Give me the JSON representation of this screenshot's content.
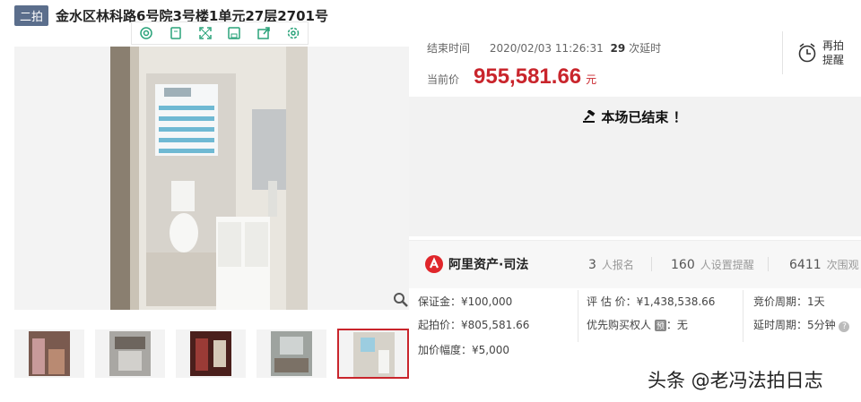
{
  "header": {
    "tag": "二拍",
    "title": "金水区林科路6号院3号楼1单元27层2701号"
  },
  "toolbar": {
    "icons": [
      "at-icon",
      "copy-icon",
      "fullscreen-icon",
      "save-icon",
      "share-icon",
      "settings-icon"
    ]
  },
  "auction": {
    "end_label": "结束时间",
    "end_time": "2020/02/03 11:26:31",
    "delay_count": "29",
    "delay_label": "次延时",
    "price_label": "当前价",
    "price": "955,581.66",
    "price_unit": "元",
    "remind_label": "再拍提醒",
    "ended_text": "本场已结束 ！"
  },
  "stats": {
    "logo_text": "阿里资产·司法",
    "signups_num": "3",
    "signups_label": "人报名",
    "reminders_num": "160",
    "reminders_label": "人设置提醒",
    "views_num": "6411",
    "views_label": "次围观"
  },
  "details": {
    "deposit": "保证金：¥100,000",
    "start_price": "起拍价：¥805,581.66",
    "increment": "加价幅度：¥5,000",
    "appraisal": "评 估 价：¥1,438,538.66",
    "priority_label": "优先购买权人",
    "priority_badge": "预",
    "priority_value": "：无",
    "cycle": "竞价周期：1天",
    "delay_cycle": "延时周期：5分钟"
  },
  "watermark": "头条 @老冯法拍日志",
  "colors": {
    "accent": "#c9252c",
    "tag_bg": "#5b6e8c",
    "toolbar_icon": "#2aa37a"
  }
}
